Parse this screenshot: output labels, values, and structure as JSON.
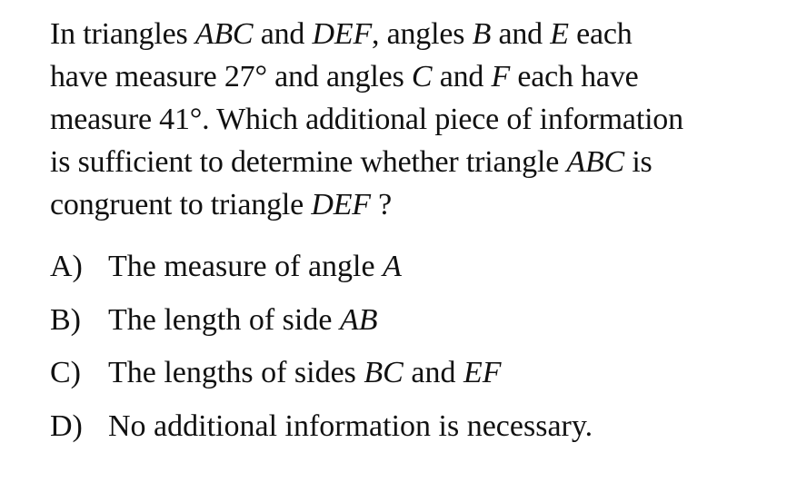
{
  "question": {
    "line1": [
      {
        "t": "In triangles ",
        "i": false
      },
      {
        "t": "ABC",
        "i": true
      },
      {
        "t": " and ",
        "i": false
      },
      {
        "t": "DEF",
        "i": true
      },
      {
        "t": ", angles ",
        "i": false
      },
      {
        "t": "B",
        "i": true
      },
      {
        "t": " and ",
        "i": false
      },
      {
        "t": "E",
        "i": true
      },
      {
        "t": " each",
        "i": false
      }
    ],
    "line2": [
      {
        "t": "have measure 27° and angles ",
        "i": false
      },
      {
        "t": "C",
        "i": true
      },
      {
        "t": " and ",
        "i": false
      },
      {
        "t": "F",
        "i": true
      },
      {
        "t": " each have",
        "i": false
      }
    ],
    "line3": [
      {
        "t": "measure 41°. Which additional piece of information",
        "i": false
      }
    ],
    "line4": [
      {
        "t": "is sufficient to determine whether triangle ",
        "i": false
      },
      {
        "t": "ABC",
        "i": true
      },
      {
        "t": " is",
        "i": false
      }
    ],
    "line5": [
      {
        "t": "congruent to triangle ",
        "i": false
      },
      {
        "t": "DEF",
        "i": true
      },
      {
        "t": " ?",
        "i": false
      }
    ]
  },
  "choices": [
    {
      "letter": "A)",
      "parts": [
        {
          "t": "The measure of angle ",
          "i": false
        },
        {
          "t": "A",
          "i": true
        }
      ]
    },
    {
      "letter": "B)",
      "parts": [
        {
          "t": "The length of side ",
          "i": false
        },
        {
          "t": "AB",
          "i": true
        }
      ]
    },
    {
      "letter": "C)",
      "parts": [
        {
          "t": "The lengths of sides ",
          "i": false
        },
        {
          "t": "BC",
          "i": true
        },
        {
          "t": " and ",
          "i": false
        },
        {
          "t": "EF",
          "i": true
        }
      ]
    },
    {
      "letter": "D)",
      "parts": [
        {
          "t": "No additional information is necessary.",
          "i": false
        }
      ]
    }
  ]
}
